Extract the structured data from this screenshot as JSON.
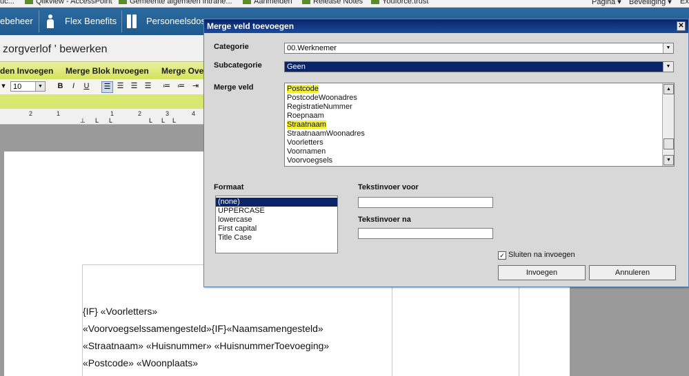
{
  "favorites": {
    "items": [
      "uc...",
      "Qlikview - AccessPoint",
      "Gemeente algemeen intrane...",
      "Aanmelden",
      "Release Notes",
      "Youforce.trust"
    ],
    "right": [
      "Pagina ▾",
      "Beveiliging ▾",
      "Ex"
    ]
  },
  "nav": {
    "items": [
      "ebeheer",
      "Flex Benefits",
      "Personeelsdos"
    ]
  },
  "page_title": "zorgverlof ' bewerken",
  "ribbon": {
    "items": [
      "den Invoegen",
      "Merge Blok Invoegen",
      "Merge Ove"
    ]
  },
  "toolbar": {
    "font_size": "10",
    "bold": "B",
    "italic": "I",
    "underline": "U"
  },
  "ruler": {
    "numbers": [
      "2",
      "1",
      "1",
      "2",
      "3",
      "4"
    ]
  },
  "document": {
    "lines": [
      "{IF} «Voorletters»",
      "«Voorvoegselssamengesteld»{IF}«Naamsamengesteld»",
      "«Straatnaam» «Huisnummer» «HuisnummerToevoeging»",
      "«Postcode» «Woonplaats»"
    ]
  },
  "dialog": {
    "title": "Merge veld toevoegen",
    "close": "✕",
    "categorie_label": "Categorie",
    "categorie_value": "00.Werknemer",
    "subcategorie_label": "Subcategorie",
    "subcategorie_value": "Geen",
    "mergeveld_label": "Merge veld",
    "merge_fields": [
      {
        "text": "Postcode",
        "highlight": true
      },
      {
        "text": "PostcodeWoonadres",
        "highlight": false
      },
      {
        "text": "RegistratieNummer",
        "highlight": false
      },
      {
        "text": "Roepnaam",
        "highlight": false
      },
      {
        "text": "Straatnaam",
        "highlight": true
      },
      {
        "text": "StraatnaamWoonadres",
        "highlight": false
      },
      {
        "text": "Voorletters",
        "highlight": false
      },
      {
        "text": "Voornamen",
        "highlight": false
      },
      {
        "text": "Voorvoegsels",
        "highlight": false
      }
    ],
    "formaat_label": "Formaat",
    "formats": [
      {
        "text": "(none)",
        "selected": true
      },
      {
        "text": "UPPERCASE",
        "selected": false
      },
      {
        "text": "lowercase",
        "selected": false
      },
      {
        "text": "First capital",
        "selected": false
      },
      {
        "text": "Title Case",
        "selected": false
      }
    ],
    "tekst_voor_label": "Tekstinvoer voor",
    "tekst_na_label": "Tekstinvoer na",
    "tekst_voor_value": "",
    "tekst_na_value": "",
    "sluiten_label": "Sluiten na invoegen",
    "sluiten_checked": true,
    "invoegen_label": "Invoegen",
    "annuleren_label": "Annuleren"
  },
  "colors": {
    "nav_bg": "#1f5a8e",
    "ribbon_bg": "#d4e25a",
    "dialog_title_bg": "#0a246a",
    "highlight": "#f3f033",
    "selection": "#0a246a"
  }
}
